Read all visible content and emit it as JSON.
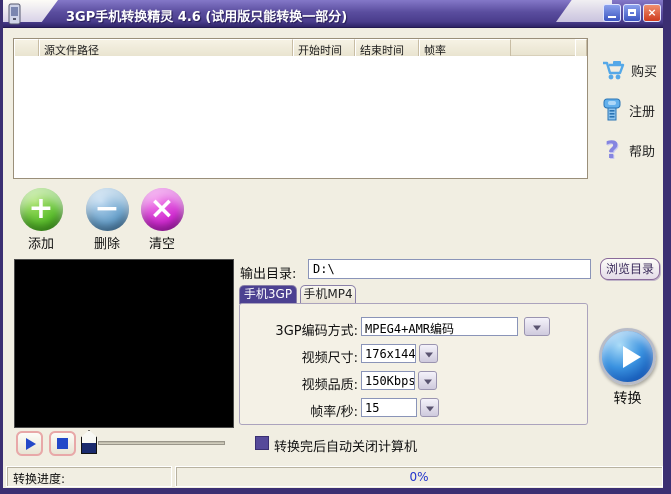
{
  "titlebar": {
    "title": "3GP手机转换精灵 4.6 (试用版只能转换一部分)"
  },
  "file_list": {
    "columns": [
      "源文件路径",
      "开始时间",
      "结束时间",
      "帧率"
    ]
  },
  "side_buttons": {
    "buy": "购买",
    "register": "注册",
    "help": "帮助",
    "help_glyph": "?"
  },
  "toolbar": {
    "add": "添加",
    "remove": "删除",
    "clear": "清空",
    "add_glyph": "+",
    "remove_glyph": "−",
    "clear_glyph": "×"
  },
  "output": {
    "label": "输出目录:",
    "value": "D:\\",
    "browse": "浏览目录"
  },
  "tabs": {
    "tab_3gp": "手机3GP",
    "tab_mp4": "手机MP4",
    "selected": "手机3GP"
  },
  "settings": {
    "encoding_label": "3GP编码方式:",
    "encoding_value": "MPEG4+AMR编码",
    "size_label": "视频尺寸:",
    "size_value": "176x144",
    "quality_label": "视频品质:",
    "quality_value": "150Kbps",
    "fps_label": "帧率/秒:",
    "fps_value": "15"
  },
  "convert": {
    "label": "转换"
  },
  "checkbox": {
    "label": "转换完后自动关闭计算机",
    "checked": false
  },
  "statusbar": {
    "label": "转换进度:",
    "progress": "0%"
  },
  "colors": {
    "titlebar_purple": "#5a4d9e",
    "window_border": "#3b2f72",
    "dialog_bg": "#f1eee2",
    "selected_tab": "#4c4191",
    "convert_blue": "#1f6fd0",
    "add_green": "#5cbe2e",
    "remove_blue": "#6aa2cc",
    "clear_pink": "#d22cd2",
    "progress_text": "#2233cc"
  }
}
